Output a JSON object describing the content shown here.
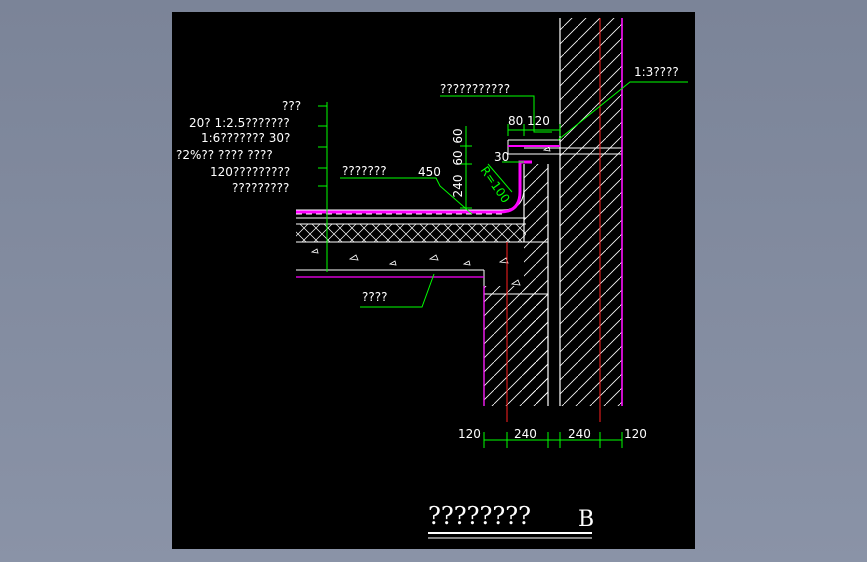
{
  "colors": {
    "background": "#000000",
    "outline": "#ffffff",
    "dimension": "#00ff00",
    "waterproof": "#ff00ff",
    "axis": "#ff2020",
    "leader": "#00ff00"
  },
  "labels": {
    "layer_1": "???",
    "layer_2": "20? 1:2.5???????",
    "layer_3": "1:6??????? 30?",
    "layer_4": "?2%?? ???? ????",
    "layer_5": "120?????????",
    "layer_6": "?????????",
    "top_note": "???????????",
    "right_note": "1:3????",
    "mid_note": "???????",
    "bottom_note": "????",
    "title": "????????",
    "title_letter": "B"
  },
  "dimensions": {
    "d60_upper": "60",
    "d60_lower": "60",
    "d240": "240",
    "d450": "450",
    "d80": "80",
    "d120_top": "120",
    "d30": "30",
    "radius": "R=100",
    "bottom_120_left": "120",
    "bottom_240_left": "240",
    "bottom_240_right": "240",
    "bottom_120_right": "120"
  },
  "icons": {
    "drawing": "cad-detail-drawing"
  }
}
